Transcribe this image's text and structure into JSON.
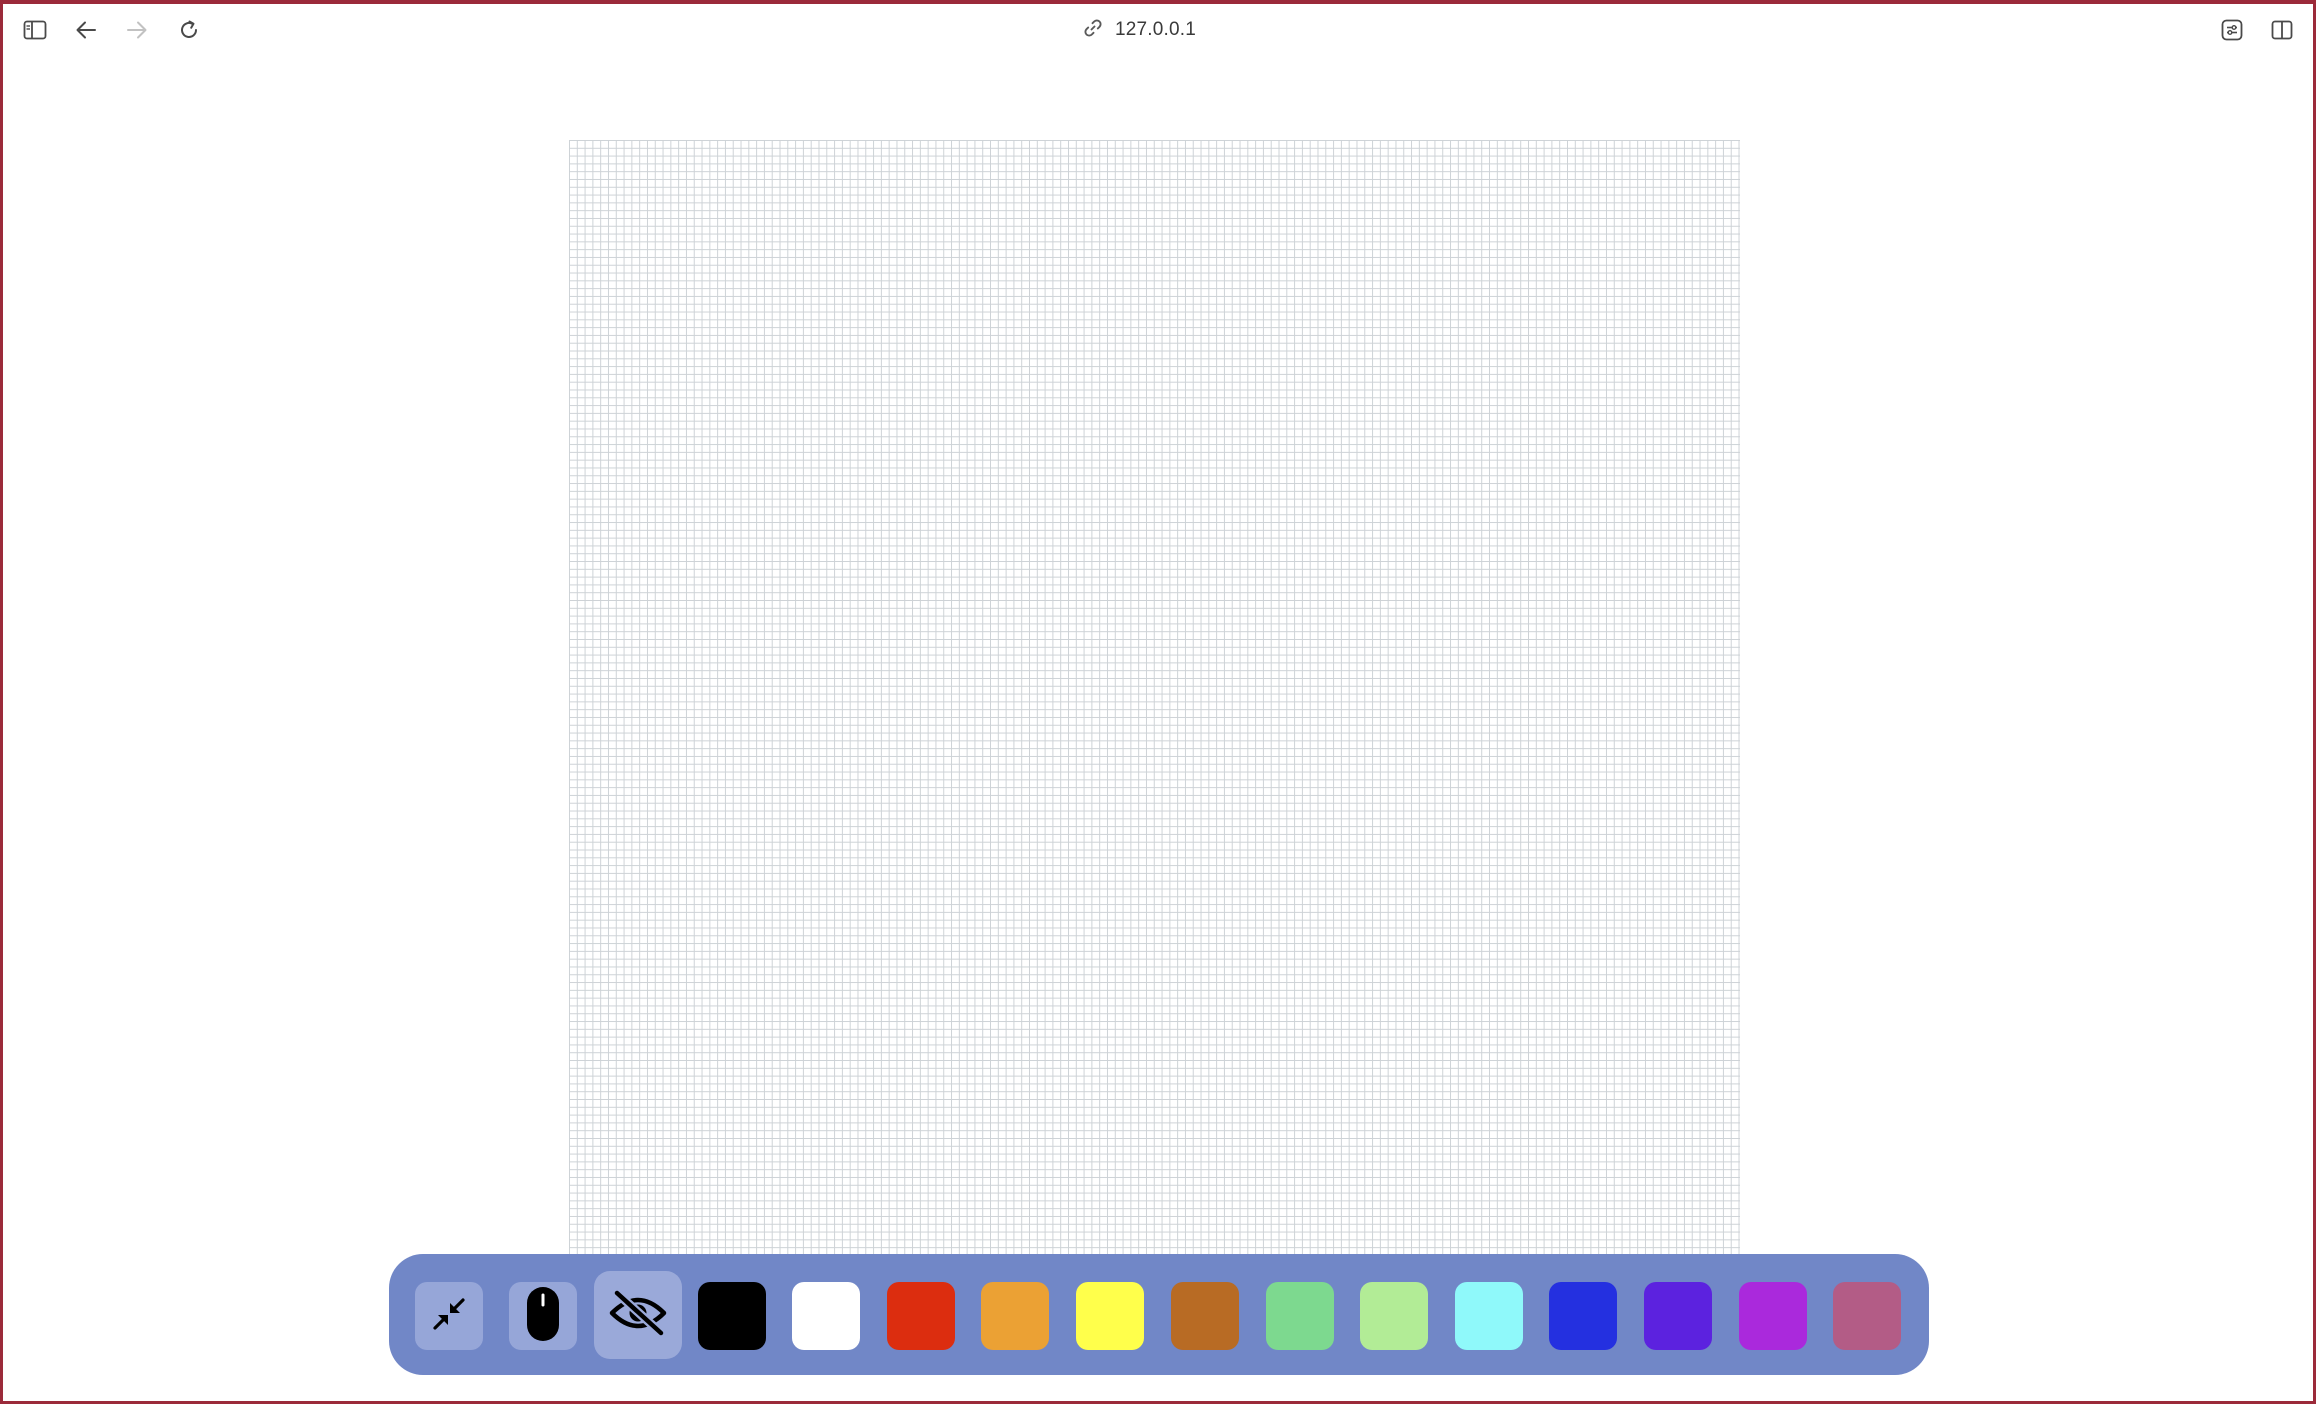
{
  "browser": {
    "url": "127.0.0.1",
    "icons": {
      "sidebar": "sidebar-toggle-icon",
      "back": "back-arrow-icon",
      "forward": "forward-arrow-icon",
      "reload": "reload-icon",
      "link": "link-icon",
      "extensions": "extensions-icon",
      "split_view": "split-view-icon"
    }
  },
  "palette": {
    "background_color": "#7187c7",
    "tools": [
      {
        "name": "collapse",
        "icon": "collapse-arrows-icon"
      },
      {
        "name": "mouse",
        "icon": "mouse-icon"
      },
      {
        "name": "hide",
        "icon": "eye-slash-icon",
        "active": true
      }
    ],
    "colors": [
      {
        "name": "black",
        "hex": "#000000"
      },
      {
        "name": "white",
        "hex": "#ffffff"
      },
      {
        "name": "red",
        "hex": "#dc2d0f"
      },
      {
        "name": "orange",
        "hex": "#eba134"
      },
      {
        "name": "yellow",
        "hex": "#ffff4b"
      },
      {
        "name": "brown",
        "hex": "#b86b24"
      },
      {
        "name": "green",
        "hex": "#7dd98f"
      },
      {
        "name": "light-green",
        "hex": "#b2ec96"
      },
      {
        "name": "cyan",
        "hex": "#8ff9fa"
      },
      {
        "name": "blue",
        "hex": "#2430e0"
      },
      {
        "name": "indigo",
        "hex": "#5c22df"
      },
      {
        "name": "purple",
        "hex": "#aa29dc"
      },
      {
        "name": "mauve",
        "hex": "#b35c86"
      }
    ]
  },
  "canvas": {
    "grid_color": "#cdd2d6",
    "background": "#ffffff"
  }
}
